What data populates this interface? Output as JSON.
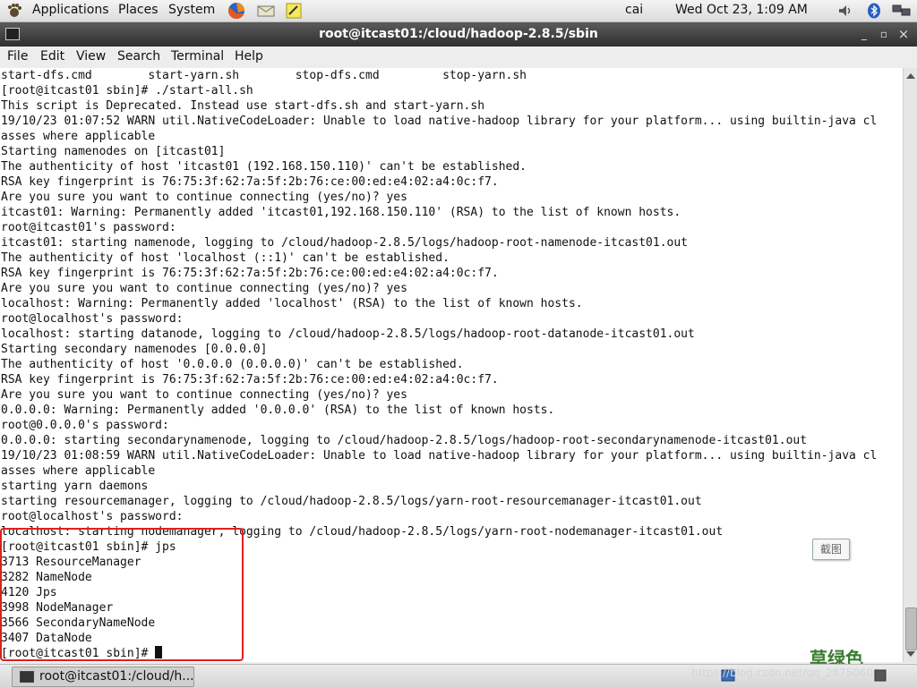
{
  "top_panel": {
    "menus": [
      "Applications",
      "Places",
      "System"
    ],
    "user": "cai",
    "clock": "Wed Oct 23,  1:09 AM"
  },
  "window": {
    "title": "root@itcast01:/cloud/hadoop-2.8.5/sbin",
    "minimize": "_",
    "maximize": "▫",
    "close": "×"
  },
  "menubar": [
    "File",
    "Edit",
    "View",
    "Search",
    "Terminal",
    "Help"
  ],
  "terminal": {
    "lines": [
      "start-dfs.cmd        start-yarn.sh        stop-dfs.cmd         stop-yarn.sh",
      "[root@itcast01 sbin]# ./start-all.sh",
      "This script is Deprecated. Instead use start-dfs.sh and start-yarn.sh",
      "19/10/23 01:07:52 WARN util.NativeCodeLoader: Unable to load native-hadoop library for your platform... using builtin-java cl",
      "asses where applicable",
      "Starting namenodes on [itcast01]",
      "The authenticity of host 'itcast01 (192.168.150.110)' can't be established.",
      "RSA key fingerprint is 76:75:3f:62:7a:5f:2b:76:ce:00:ed:e4:02:a4:0c:f7.",
      "Are you sure you want to continue connecting (yes/no)? yes",
      "itcast01: Warning: Permanently added 'itcast01,192.168.150.110' (RSA) to the list of known hosts.",
      "root@itcast01's password:",
      "itcast01: starting namenode, logging to /cloud/hadoop-2.8.5/logs/hadoop-root-namenode-itcast01.out",
      "The authenticity of host 'localhost (::1)' can't be established.",
      "RSA key fingerprint is 76:75:3f:62:7a:5f:2b:76:ce:00:ed:e4:02:a4:0c:f7.",
      "Are you sure you want to continue connecting (yes/no)? yes",
      "localhost: Warning: Permanently added 'localhost' (RSA) to the list of known hosts.",
      "root@localhost's password:",
      "localhost: starting datanode, logging to /cloud/hadoop-2.8.5/logs/hadoop-root-datanode-itcast01.out",
      "Starting secondary namenodes [0.0.0.0]",
      "The authenticity of host '0.0.0.0 (0.0.0.0)' can't be established.",
      "RSA key fingerprint is 76:75:3f:62:7a:5f:2b:76:ce:00:ed:e4:02:a4:0c:f7.",
      "Are you sure you want to continue connecting (yes/no)? yes",
      "0.0.0.0: Warning: Permanently added '0.0.0.0' (RSA) to the list of known hosts.",
      "root@0.0.0.0's password:",
      "0.0.0.0: starting secondarynamenode, logging to /cloud/hadoop-2.8.5/logs/hadoop-root-secondarynamenode-itcast01.out",
      "19/10/23 01:08:59 WARN util.NativeCodeLoader: Unable to load native-hadoop library for your platform... using builtin-java cl",
      "asses where applicable",
      "starting yarn daemons",
      "starting resourcemanager, logging to /cloud/hadoop-2.8.5/logs/yarn-root-resourcemanager-itcast01.out",
      "root@localhost's password:",
      "localhost: starting nodemanager, logging to /cloud/hadoop-2.8.5/logs/yarn-root-nodemanager-itcast01.out",
      "[root@itcast01 sbin]# jps",
      "3713 ResourceManager",
      "3282 NameNode",
      "4120 Jps",
      "3998 NodeManager",
      "3566 SecondaryNameNode",
      "3407 DataNode"
    ],
    "prompt": "[root@itcast01 sbin]# "
  },
  "snip_button": "截图",
  "watermark": "草绿色",
  "taskbar": {
    "window_button": "root@itcast01:/cloud/h...",
    "url": "https://blog.csdn.net/qq_28750600"
  },
  "colors": {
    "highlight_box": "#e0201c",
    "watermark": "#3a7d2e"
  }
}
